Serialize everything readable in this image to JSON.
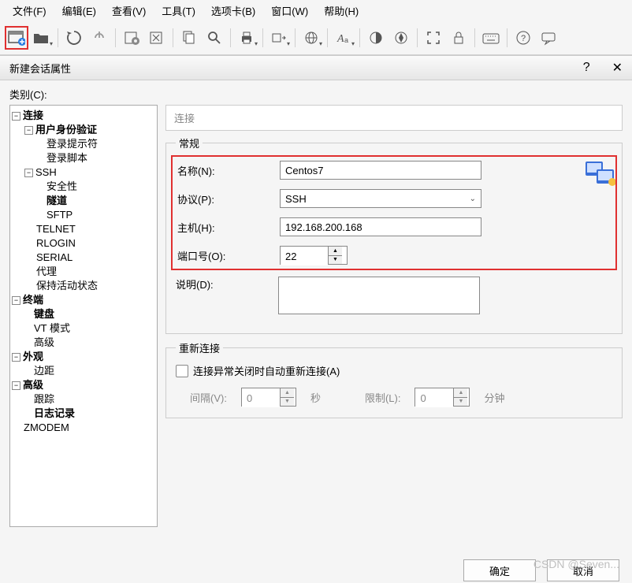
{
  "menu": {
    "file": "文件(F)",
    "edit": "编辑(E)",
    "view": "查看(V)",
    "tools": "工具(T)",
    "tabs": "选项卡(B)",
    "window": "窗口(W)",
    "help": "帮助(H)"
  },
  "dialog": {
    "title": "新建会话属性",
    "help": "?",
    "close": "✕",
    "category_label": "类别(C):"
  },
  "tree": {
    "connection": "连接",
    "user_auth": "用户身份验证",
    "login_prompt": "登录提示符",
    "login_script": "登录脚本",
    "ssh": "SSH",
    "security": "安全性",
    "tunnel": "隧道",
    "sftp": "SFTP",
    "telnet": "TELNET",
    "rlogin": "RLOGIN",
    "serial": "SERIAL",
    "proxy": "代理",
    "keepalive": "保持活动状态",
    "terminal": "终端",
    "keyboard": "键盘",
    "vt_mode": "VT 模式",
    "advanced_term": "高级",
    "appearance": "外观",
    "margin": "边距",
    "advanced": "高级",
    "trace": "跟踪",
    "logging": "日志记录",
    "zmodem": "ZMODEM",
    "minus": "−"
  },
  "panel": {
    "head": "连接",
    "general_legend": "常规",
    "name_label": "名称(N):",
    "name_value": "Centos7",
    "protocol_label": "协议(P):",
    "protocol_value": "SSH",
    "host_label": "主机(H):",
    "host_value": "192.168.200.168",
    "port_label": "端口号(O):",
    "port_value": "22",
    "desc_label": "说明(D):",
    "reconnect_legend": "重新连接",
    "auto_reconnect_cb": "连接异常关闭时自动重新连接(A)",
    "interval_label": "间隔(V):",
    "interval_value": "0",
    "interval_unit": "秒",
    "limit_label": "限制(L):",
    "limit_value": "0",
    "limit_unit": "分钟"
  },
  "buttons": {
    "ok": "确定",
    "cancel": "取消"
  },
  "watermark": "CSDN @Seven..."
}
